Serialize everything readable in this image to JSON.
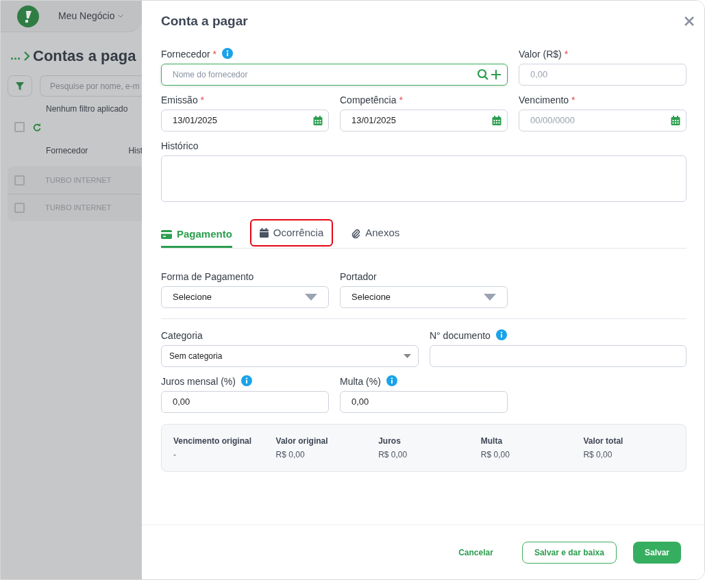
{
  "background": {
    "business": "Meu Negócio",
    "breadcrumb": "...",
    "page_title": "Contas a paga",
    "search_placeholder": "Pesquise por nome, e-m",
    "filter_status": "Nenhum filtro aplicado",
    "select_all_checked": false,
    "columns": [
      "Fornecedor",
      "Hist"
    ],
    "rows": [
      {
        "supplier": "TURBO INTERNET",
        "checked": false
      },
      {
        "supplier": "TURBO INTERNET",
        "checked": false
      }
    ]
  },
  "modal": {
    "title": "Conta a pagar",
    "fornecedor": {
      "label": "Fornecedor",
      "required_mark": "*",
      "placeholder": "Nome do fornecedor"
    },
    "valor": {
      "label": "Valor (R$)",
      "required_mark": "*",
      "placeholder": "0,00"
    },
    "dates": [
      {
        "label": "Emissão",
        "required_mark": "*",
        "value": "13/01/2025"
      },
      {
        "label": "Competência",
        "required_mark": "*",
        "value": "13/01/2025"
      },
      {
        "label": "Vencimento",
        "required_mark": "*",
        "placeholder": "00/00/0000"
      }
    ],
    "historico": {
      "label": "Histórico"
    },
    "tabs": [
      {
        "label": "Pagamento",
        "selected": true,
        "highlighted": false
      },
      {
        "label": "Ocorrência",
        "selected": false,
        "highlighted": true
      },
      {
        "label": "Anexos",
        "selected": false,
        "highlighted": false
      }
    ],
    "selects": [
      {
        "label": "Forma de Pagamento",
        "value": "Selecione"
      },
      {
        "label": "Portador",
        "value": "Selecione"
      }
    ],
    "categoria": {
      "label": "Categoria",
      "value": "Sem categoria"
    },
    "documento": {
      "label": "N° documento"
    },
    "juros": {
      "label": "Juros mensal (%)",
      "value": "0,00"
    },
    "multa": {
      "label": "Multa (%)",
      "value": "0,00"
    },
    "summary": [
      {
        "label": "Vencimento original",
        "value": "-"
      },
      {
        "label": "Valor original",
        "value": "R$ 0,00"
      },
      {
        "label": "Juros",
        "value": "R$ 0,00"
      },
      {
        "label": "Multa",
        "value": "R$ 0,00"
      },
      {
        "label": "Valor total",
        "value": "R$ 0,00"
      }
    ],
    "buttons": [
      {
        "label": "Cancelar",
        "kind": "text"
      },
      {
        "label": "Salvar e dar baixa",
        "kind": "outline"
      },
      {
        "label": "Salvar",
        "kind": "primary"
      }
    ]
  }
}
